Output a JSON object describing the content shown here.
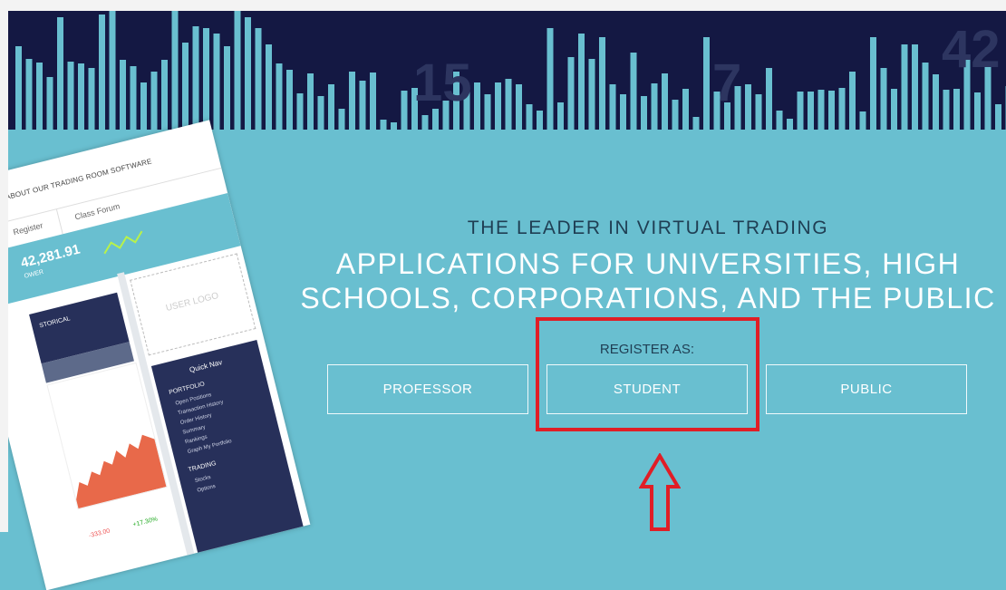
{
  "banner": {
    "bar_heights": [
      92,
      78,
      74,
      58,
      124,
      75,
      73,
      68,
      127,
      132,
      77,
      70,
      52,
      64,
      77,
      133,
      96,
      114,
      112,
      106,
      92,
      134,
      124,
      112,
      94,
      73,
      66,
      40,
      62,
      37,
      50,
      23,
      64,
      54,
      63,
      11,
      8,
      43,
      46,
      16,
      23,
      32,
      64,
      45,
      52,
      39,
      52,
      56,
      50,
      28,
      21,
      112,
      30,
      80,
      106,
      78,
      102,
      50,
      39,
      85,
      37,
      51,
      62,
      33,
      45,
      14,
      102,
      42,
      30,
      48,
      50,
      39,
      68,
      21,
      12,
      42,
      42,
      44,
      43,
      46,
      64,
      20,
      102,
      68,
      45,
      94,
      94,
      74,
      61,
      44,
      45,
      77,
      41,
      71,
      28,
      48
    ],
    "numbers": [
      "15",
      "7",
      "42"
    ]
  },
  "hero": {
    "tagline": "THE LEADER IN VIRTUAL TRADING",
    "headline_line1": "APPLICATIONS FOR UNIVERSITIES, HIGH",
    "headline_line2": "SCHOOLS, CORPORATIONS, AND THE PUBLIC"
  },
  "register": {
    "label": "REGISTER AS:",
    "buttons": {
      "professor": "PROFESSOR",
      "student": "STUDENT",
      "public": "PUBLIC"
    }
  },
  "annotation": {
    "box_color": "#e01e26",
    "arrow_color": "#e01e26"
  },
  "device": {
    "learn_more": "RN MORE ABOUT OUR TRADING ROOM SOFTWARE",
    "tabs": [
      "Register",
      "Class Forum"
    ],
    "value": "42,281.91",
    "owner": "OWER",
    "historical": "STORICAL",
    "user_logo": "USER LOGO",
    "quick_nav": {
      "title": "Quick Nav",
      "portfolio_head": "PORTFOLIO",
      "portfolio_items": [
        "Open Positions",
        "Transaction History",
        "Order History",
        "Summary",
        "Rankings",
        "Graph My Portfolio"
      ],
      "trading_head": "TRADING",
      "trading_items": [
        "Stocks",
        "Options"
      ]
    },
    "footer_neg": "-333.00",
    "footer_pos": "+17.30%"
  },
  "colors": {
    "page_bg": "#69bfd0",
    "banner_bg": "#141843",
    "bar_color": "#69bfd0",
    "accent_red": "#e01e26"
  }
}
